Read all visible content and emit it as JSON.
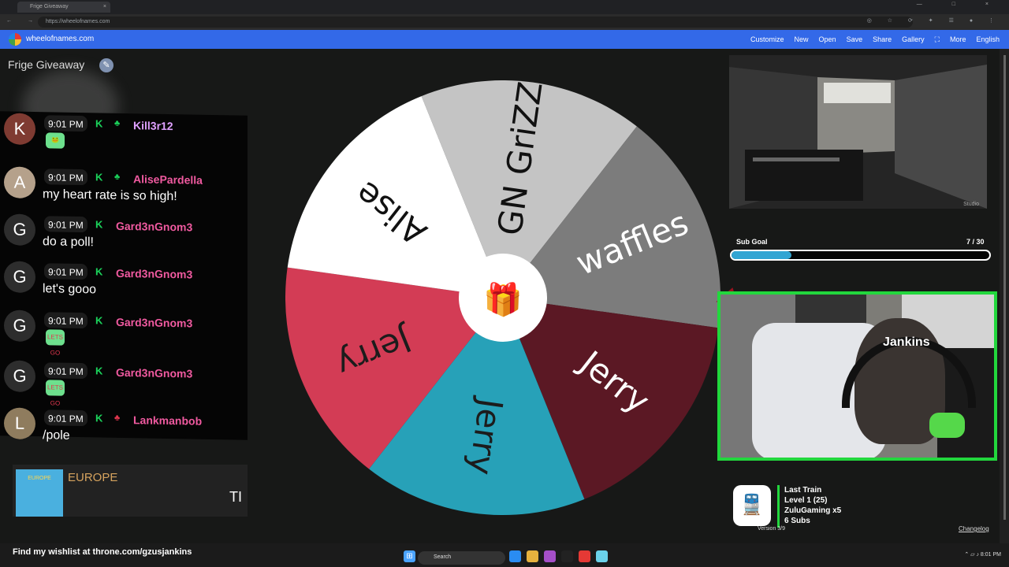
{
  "browser": {
    "tab_title": "Frige Giveaway",
    "tab_close": "×",
    "window_controls": "— □ ×",
    "nav_icons": "← → ↻",
    "url": "https://wheelofnames.com",
    "toolbar_icons": "◎ ☆ ⟳ ✦ ☰ ● ⋮"
  },
  "app": {
    "site_name": "wheelofnames.com",
    "menu": [
      "Customize",
      "New",
      "Open",
      "Save",
      "Share",
      "Gallery",
      "⛶",
      "More",
      "English"
    ],
    "wheel_title": "Frige Giveaway",
    "edit_icon": "✎"
  },
  "chat": {
    "messages": [
      {
        "time": "9:01 PM",
        "user": "Kill3r12",
        "text": "",
        "avatar": "K",
        "emote": "🐸",
        "color": "#dfa0ff"
      },
      {
        "time": "9:01 PM",
        "user": "AlisePardella",
        "text": "my heart rate is so high!",
        "avatar": "A",
        "emote": "",
        "color": "#f05aa0"
      },
      {
        "time": "9:01 PM",
        "user": "Gard3nGnom3",
        "text": "do a poll!",
        "avatar": "G",
        "emote": "",
        "color": "#f05aa0"
      },
      {
        "time": "9:01 PM",
        "user": "Gard3nGnom3",
        "text": "let's gooo",
        "avatar": "G",
        "emote": "",
        "color": "#f05aa0"
      },
      {
        "time": "9:01 PM",
        "user": "Gard3nGnom3",
        "text": "",
        "avatar": "G",
        "emote": "LETS GO",
        "color": "#f05aa0"
      },
      {
        "time": "9:01 PM",
        "user": "Gard3nGnom3",
        "text": "",
        "avatar": "G",
        "emote": "LETS GO",
        "color": "#f05aa0"
      },
      {
        "time": "9:01 PM",
        "user": "Lankmanbob",
        "text": "/pole",
        "avatar": "L",
        "emote": "",
        "color": "#f05aa0"
      }
    ],
    "badge": "K",
    "badge_secondary": "♣"
  },
  "now_playing": {
    "album": "EUROPE",
    "title": "EUROPE",
    "subtitle": "TI"
  },
  "wheel": {
    "segments": [
      {
        "label": "GN GriZZ",
        "color": "#c4c4c4",
        "text_color": "#111111"
      },
      {
        "label": "waffles",
        "color": "#7c7c7c",
        "text_color": "#ffffff"
      },
      {
        "label": "Jerry",
        "color": "#5b1824",
        "text_color": "#ffffff"
      },
      {
        "label": "Jerry",
        "color": "#27a1b8",
        "text_color": "#1c1c1c"
      },
      {
        "label": "Jerry",
        "color": "#d33c55",
        "text_color": "#1c1c1c"
      },
      {
        "label": "Alise",
        "color": "#ffffff",
        "text_color": "#111111"
      }
    ],
    "center_icon": "🎁"
  },
  "camera_top": {
    "label": "Studio"
  },
  "sub_goal": {
    "label": "Sub Goal",
    "count": "7 / 30",
    "progress": 0.233
  },
  "webcam": {
    "cap_text": "Jankins"
  },
  "train": {
    "icon": "🚆",
    "lines": [
      "Last Train",
      "Level 1  (25)",
      "ZuluGaming x5",
      "6 Subs"
    ],
    "version": "Version 3/9",
    "changelog": "Changelog"
  },
  "footer": {
    "wishlist": "Find my wishlist at throne.com/gzusjankins",
    "search": "Search",
    "tray": "⌃  ▱  ♪  8:01 PM"
  }
}
